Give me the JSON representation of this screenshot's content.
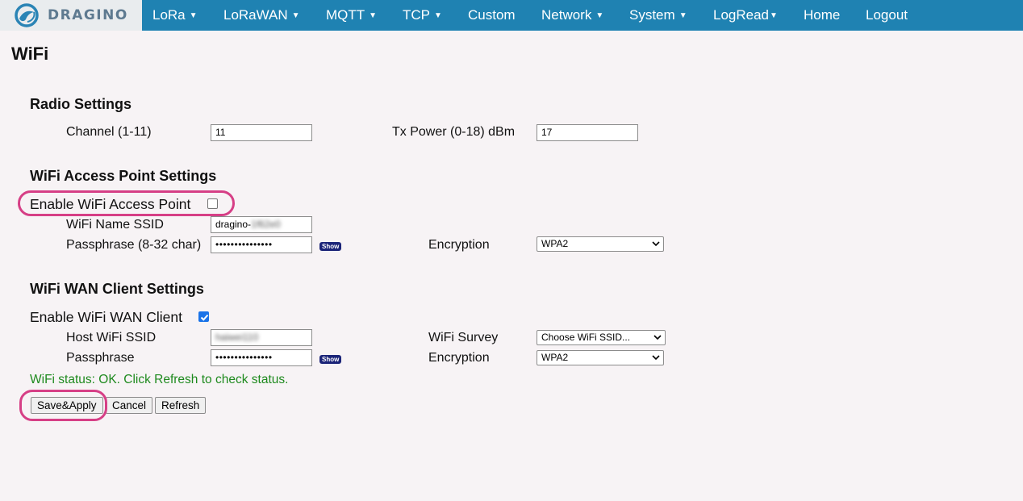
{
  "brand": {
    "name": "DRAGINO"
  },
  "nav": [
    {
      "label": "LoRa",
      "caret": "▼"
    },
    {
      "label": "LoRaWAN",
      "caret": "▼"
    },
    {
      "label": "MQTT",
      "caret": "▼"
    },
    {
      "label": "TCP",
      "caret": "▼"
    },
    {
      "label": "Custom"
    },
    {
      "label": "Network",
      "caret": "▼"
    },
    {
      "label": "System",
      "caret": "▼"
    },
    {
      "label": "LogRead",
      "caret": "▼"
    },
    {
      "label": "Home"
    },
    {
      "label": "Logout"
    }
  ],
  "page": {
    "title": "WiFi"
  },
  "radio": {
    "title": "Radio Settings",
    "channel_label": "Channel (1-11)",
    "channel_value": "11",
    "txpower_label": "Tx Power (0-18) dBm",
    "txpower_value": "17"
  },
  "ap": {
    "title": "WiFi Access Point Settings",
    "enable_label": "Enable WiFi Access Point",
    "enabled": false,
    "ssid_label": "WiFi Name SSID",
    "ssid_prefix": "dragino-",
    "ssid_suffix_blurred": "1f62e0",
    "passphrase_label": "Passphrase (8-32 char)",
    "passphrase_masked": "•••••••••••••••",
    "show_label": "Show",
    "encryption_label": "Encryption",
    "encryption_value": "WPA2"
  },
  "wan": {
    "title": "WiFi WAN Client Settings",
    "enable_label": "Enable WiFi WAN Client",
    "enabled": true,
    "host_ssid_label": "Host WiFi SSID",
    "host_ssid_blurred": "haiwei110",
    "survey_label": "WiFi Survey",
    "survey_value": "Choose WiFi SSID...",
    "passphrase_label": "Passphrase",
    "passphrase_masked": "•••••••••••••••",
    "show_label": "Show",
    "encryption_label": "Encryption",
    "encryption_value": "WPA2"
  },
  "status": {
    "text": "WiFi status: OK. Click Refresh to check status.",
    "color": "#1e8a1e"
  },
  "buttons": {
    "save": "Save&Apply",
    "cancel": "Cancel",
    "refresh": "Refresh"
  },
  "colors": {
    "nav_bg": "#1f82b2",
    "page_bg": "#f7f3f5",
    "highlight": "#d63f86",
    "show_btn": "#1b2478"
  },
  "icons": {
    "logo": "dragino-logo-icon",
    "dropdown": "chevron-down-icon",
    "caret": "caret-down-icon",
    "check": "checkmark-icon"
  }
}
